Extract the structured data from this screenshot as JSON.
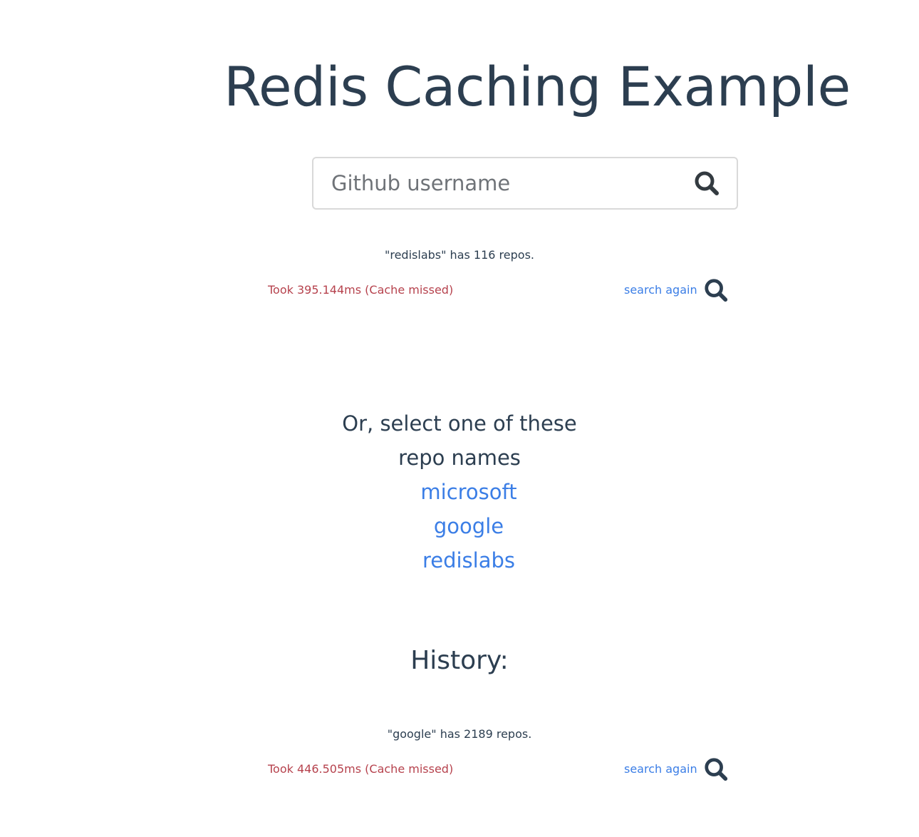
{
  "header": {
    "title": "Redis Caching Example"
  },
  "search": {
    "placeholder": "Github username",
    "icon": "search-icon"
  },
  "current_result": {
    "summary": "\"redislabs\" has 116 repos.",
    "timing": "Took 395.144ms (Cache missed)",
    "search_again_label": "search again"
  },
  "suggestions": {
    "line1": "Or, select one of these",
    "line2": "repo names",
    "items": [
      "microsoft",
      "google",
      "redislabs"
    ]
  },
  "history": {
    "heading": "History:",
    "entries": [
      {
        "summary": "\"google\" has 2189 repos.",
        "timing": "Took 446.505ms (Cache missed)",
        "search_again_label": "search again"
      }
    ]
  },
  "colors": {
    "text": "#2c3e50",
    "link": "#3b7ee6",
    "miss": "#b6424d"
  }
}
